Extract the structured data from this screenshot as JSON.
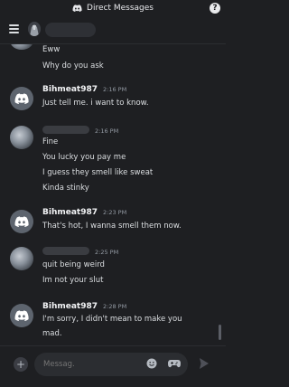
{
  "topbar": {
    "title": "Direct Messages",
    "help": "?"
  },
  "composer": {
    "placeholder": "Messag.",
    "plus": "+"
  },
  "messages": [
    {
      "lines": [
        "Eww",
        "Why do you ask"
      ]
    },
    {
      "author": "Bihmeat987",
      "time": "2:16 PM",
      "lines": [
        "Just tell me. i want to know."
      ]
    },
    {
      "time": "2:16 PM",
      "lines": [
        "Fine",
        "You lucky you pay me",
        "I guess they smell like sweat",
        "Kinda stinky"
      ]
    },
    {
      "author": "Bihmeat987",
      "time": "2:23 PM",
      "lines": [
        "That's hot, I wanna smell them now."
      ]
    },
    {
      "time": "2:25 PM",
      "lines": [
        "quit being weird",
        "Im not your slut"
      ]
    },
    {
      "author": "Bihmeat987",
      "time": "2:28 PM",
      "lines": [
        "I'm sorry, I didn't mean to make you",
        "mad."
      ]
    }
  ],
  "colors": {
    "background": "#1e1f22",
    "text": "#dbdee1",
    "muted": "#949ba4"
  },
  "icons": [
    "discord-logo-icon",
    "help-icon",
    "hamburger-icon",
    "plus-icon",
    "emoji-icon",
    "gamepad-icon",
    "send-icon",
    "discord-default-avatar-icon"
  ]
}
